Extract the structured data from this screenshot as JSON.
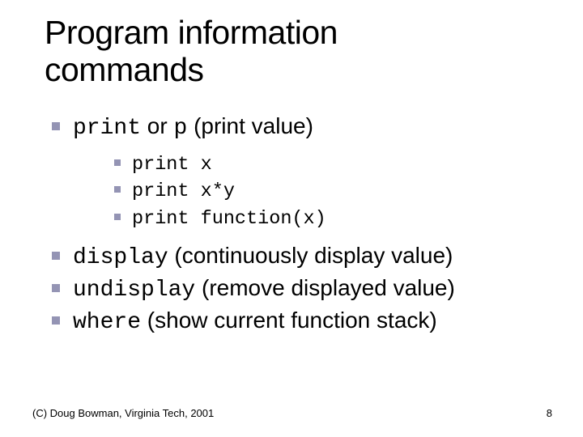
{
  "title_line1": "Program information",
  "title_line2": "commands",
  "items": {
    "print": {
      "cmd": "print",
      "or": " or ",
      "alias": "p",
      "desc": " (print value)"
    },
    "examples": {
      "e1": "print x",
      "e2": "print x*y",
      "e3": "print function(x)"
    },
    "display": {
      "cmd": "display",
      "desc": " (continuously display value)"
    },
    "undisplay": {
      "cmd": "undisplay",
      "desc": " (remove displayed value)"
    },
    "where": {
      "cmd": "where",
      "desc": " (show current function stack)"
    }
  },
  "footer": "(C) Doug Bowman, Virginia Tech, 2001",
  "page": "8"
}
